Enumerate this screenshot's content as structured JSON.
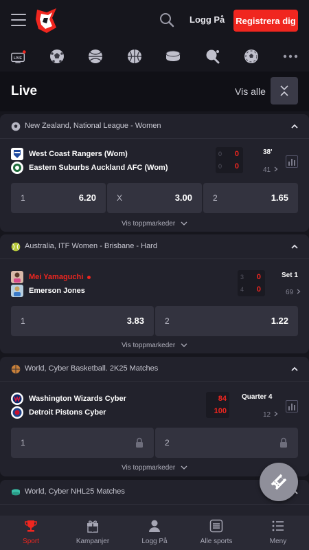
{
  "header": {
    "login_label": "Logg På",
    "register_label": "Registrera dig"
  },
  "sports_nav": {
    "items": [
      "live-tv-icon",
      "soccer-ball-icon",
      "basketball-icon",
      "basketball-alt-icon",
      "ice-hockey-puck-icon",
      "table-tennis-icon",
      "soccer-ball-alt-icon",
      "more-icon"
    ],
    "live_badge": "LIVE"
  },
  "live_section": {
    "title": "Live",
    "see_all": "Vis alle"
  },
  "events": [
    {
      "league": "New Zealand, National League - Women",
      "team1": "West Coast Rangers (Wom)",
      "team2": "Eastern Suburbs Auckland AFC (Wom)",
      "score1_prev": "0",
      "score1": "0",
      "score2_prev": "0",
      "score2": "0",
      "status": "38'",
      "markets_count": "41",
      "odds": [
        {
          "label": "1",
          "value": "6.20"
        },
        {
          "label": "X",
          "value": "3.00"
        },
        {
          "label": "2",
          "value": "1.65"
        }
      ],
      "toggle_label": "Vis toppmarkeder"
    },
    {
      "league": "Australia, ITF Women - Brisbane - Hard",
      "team1": "Mei Yamaguchi",
      "team2": "Emerson Jones",
      "score1_prev": "3",
      "score1": "0",
      "score2_prev": "4",
      "score2": "0",
      "status": "Set 1",
      "markets_count": "69",
      "odds": [
        {
          "label": "1",
          "value": "3.83"
        },
        {
          "label": "2",
          "value": "1.22"
        }
      ],
      "toggle_label": "Vis toppmarkeder"
    },
    {
      "league": "World, Cyber Basketball. 2K25 Matches",
      "team1": "Washington Wizards Cyber",
      "team2": "Detroit Pistons Cyber",
      "score1": "84",
      "score2": "100",
      "status": "Quarter 4",
      "markets_count": "12",
      "odds": [
        {
          "label": "1"
        },
        {
          "label": "2"
        }
      ],
      "toggle_label": "Vis toppmarkeder"
    },
    {
      "league": "World, Cyber NHL25 Matches"
    }
  ],
  "bottom_nav": [
    {
      "label": "Sport",
      "icon": "trophy-icon",
      "active": true
    },
    {
      "label": "Kampanjer",
      "icon": "gift-icon"
    },
    {
      "label": "Logg På",
      "icon": "user-icon"
    },
    {
      "label": "Alle sports",
      "icon": "list-icon"
    },
    {
      "label": "Meny",
      "icon": "menu-icon"
    }
  ],
  "colors": {
    "brand_red": "#f0261f",
    "background": "#16161d",
    "card": "#22222c",
    "odd_button": "#33333f"
  }
}
